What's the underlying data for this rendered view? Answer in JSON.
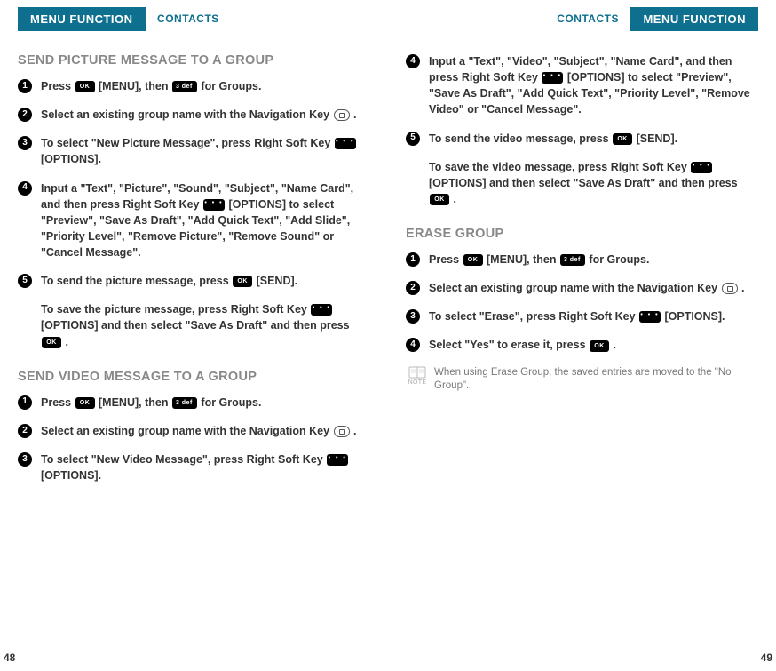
{
  "header": {
    "menu_tab": "MENU FUNCTION",
    "sub_tab": "CONTACTS"
  },
  "left": {
    "page_num": "48",
    "section1": {
      "title": "SEND PICTURE MESSAGE TO A GROUP",
      "steps": [
        {
          "pre": "Press ",
          "k1": "ok",
          "mid1": " [MENU], then ",
          "k2": "num3",
          "post": " for Groups."
        },
        {
          "pre": "Select an existing group name with the Navigation Key ",
          "k1": "nav",
          "post": " ."
        },
        {
          "pre": "To select \"New Picture Message\", press Right Soft Key ",
          "k1": "dots",
          "post": " [OPTIONS]."
        },
        {
          "pre": "Input a \"Text\", \"Picture\", \"Sound\", \"Subject\", \"Name Card\", and then press Right Soft Key ",
          "k1": "dots",
          "post": " [OPTIONS] to select \"Preview\", \"Save As Draft\", \"Add Quick Text\", \"Add Slide\", \"Priority Level\", \"Remove Picture\", \"Remove Sound\" or \"Cancel Message\"."
        },
        {
          "pre": "To send the picture message, press ",
          "k1": "ok",
          "post": " [SEND]."
        }
      ],
      "substep": {
        "pre": "To save the picture message, press Right Soft Key ",
        "k1": "dots",
        "mid1": " [OPTIONS] and then select \"Save As Draft\" and then press ",
        "k2": "ok",
        "post": " ."
      }
    },
    "section2": {
      "title": "SEND VIDEO MESSAGE TO A GROUP",
      "steps": [
        {
          "pre": "Press ",
          "k1": "ok",
          "mid1": " [MENU], then ",
          "k2": "num3",
          "post": " for Groups."
        },
        {
          "pre": "Select an existing group name with the Navigation Key ",
          "k1": "nav",
          "post": " ."
        },
        {
          "pre": "To select \"New Video Message\", press Right Soft Key ",
          "k1": "dots",
          "post": " [OPTIONS]."
        }
      ]
    }
  },
  "right": {
    "page_num": "49",
    "section1": {
      "steps": [
        {
          "num": "4",
          "pre": "Input a \"Text\", \"Video\", \"Subject\", \"Name Card\", and then press Right Soft Key  ",
          "k1": "dots",
          "post": " [OPTIONS] to select \"Preview\", \"Save As Draft\", \"Add Quick Text\", \"Priority Level\", \"Remove Video\" or \"Cancel Message\"."
        },
        {
          "num": "5",
          "pre": "To send the video message, press ",
          "k1": "ok",
          "post": " [SEND]."
        }
      ],
      "substep": {
        "pre": "To save the video message, press Right Soft Key ",
        "k1": "dots",
        "mid1": " [OPTIONS] and then select \"Save As Draft\" and then press ",
        "k2": "ok",
        "post": " ."
      }
    },
    "section2": {
      "title": "ERASE GROUP",
      "steps": [
        {
          "pre": "Press ",
          "k1": "ok",
          "mid1": " [MENU], then ",
          "k2": "num3",
          "post": " for Groups."
        },
        {
          "pre": "Select an existing group name with the Navigation Key ",
          "k1": "nav",
          "post": " ."
        },
        {
          "pre": "To select \"Erase\", press Right Soft Key ",
          "k1": "dots",
          "post": " [OPTIONS]."
        },
        {
          "pre": "Select \"Yes\" to erase it, press ",
          "k1": "ok",
          "post": " ."
        }
      ],
      "note": "When using Erase Group, the saved entries are moved to the \"No Group\".",
      "note_label": "NOTE"
    }
  },
  "keys": {
    "ok": "OK",
    "num3": "3  def",
    "dots": "• • •"
  }
}
